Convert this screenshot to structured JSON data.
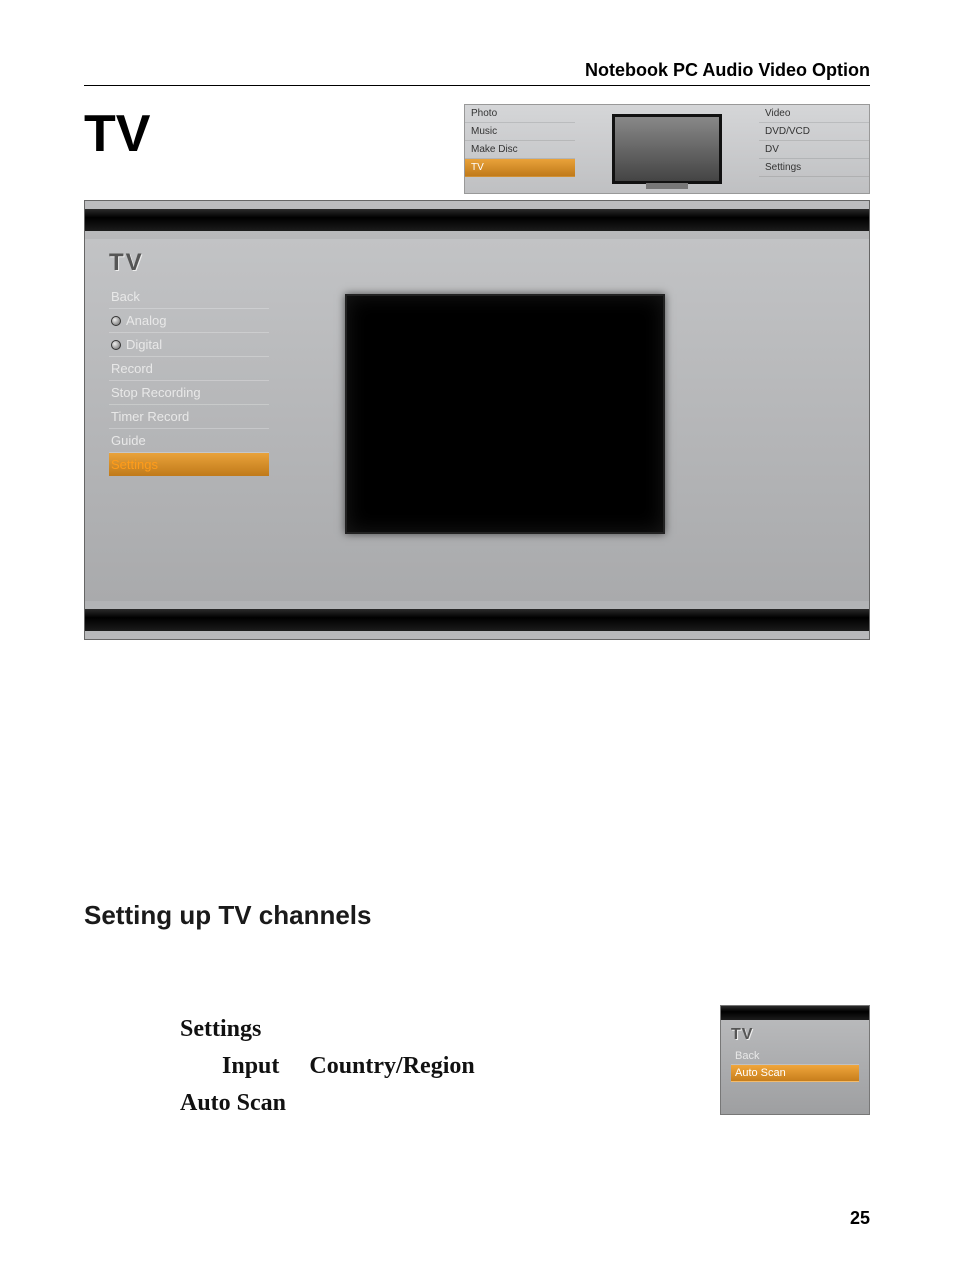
{
  "header": {
    "title": "Notebook PC Audio Video Option"
  },
  "title": "TV",
  "mini": {
    "left": [
      "Photo",
      "Music",
      "Make Disc",
      "TV"
    ],
    "selected_left_index": 3,
    "right": [
      "Video",
      "DVD/VCD",
      "DV",
      "Settings"
    ]
  },
  "tv_ui": {
    "sidebar_title": "TV",
    "items": [
      {
        "label": "Back",
        "radio": false
      },
      {
        "label": "Analog",
        "radio": true
      },
      {
        "label": "Digital",
        "radio": true
      },
      {
        "label": "Record",
        "radio": false
      },
      {
        "label": "Stop Recording",
        "radio": false
      },
      {
        "label": "Timer Record",
        "radio": false
      },
      {
        "label": "Guide",
        "radio": false
      },
      {
        "label": "Settings",
        "radio": false,
        "selected": true
      }
    ]
  },
  "section_heading": "Setting up TV channels",
  "body": {
    "kw_settings": "Settings",
    "kw_input": "Input",
    "kw_country": "Country/Region",
    "kw_autoscan": "Auto Scan"
  },
  "small_ui": {
    "title": "TV",
    "items": [
      {
        "label": "Back",
        "selected": false
      },
      {
        "label": "Auto Scan",
        "selected": true
      }
    ]
  },
  "page_number": "25"
}
